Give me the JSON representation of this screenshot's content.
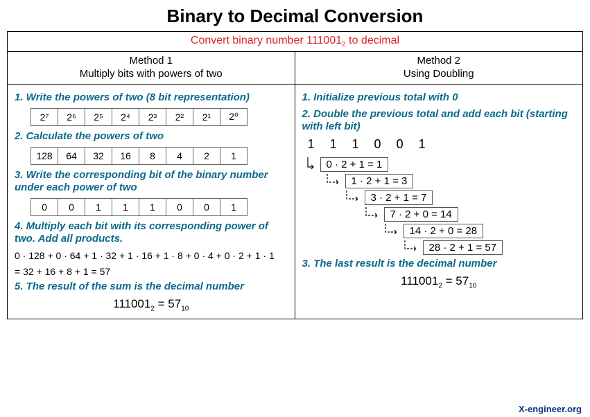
{
  "title": "Binary to Decimal Conversion",
  "prompt_prefix": "Convert binary number ",
  "prompt_bin": "111001",
  "prompt_suffix": " to decimal",
  "method1": {
    "name": "Method 1",
    "subtitle": "Multiply bits with powers of two",
    "step1": "1. Write the powers of two (8 bit representation)",
    "powers_labels": [
      "2⁷",
      "2⁶",
      "2⁵",
      "2⁴",
      "2³",
      "2²",
      "2¹",
      "2⁰"
    ],
    "step2": "2. Calculate the powers of two",
    "powers_values": [
      "128",
      "64",
      "32",
      "16",
      "8",
      "4",
      "2",
      "1"
    ],
    "step3": "3. Write the corresponding bit of the binary number under each power of two",
    "bits_row": [
      "0",
      "0",
      "1",
      "1",
      "1",
      "0",
      "0",
      "1"
    ],
    "step4": "4. Multiply each bit with its corresponding power of two. Add all products.",
    "calc_line1": "0 · 128 + 0 · 64 + 1 · 32 + 1 · 16 + 1 · 8 + 0 · 4 + 0 · 2 + 1 · 1",
    "calc_line2": "= 32 + 16 + 8 + 1 = 57",
    "step5": "5. The result of the sum is the decimal number",
    "result_bin": "111001",
    "result_dec": "57"
  },
  "method2": {
    "name": "Method 2",
    "subtitle": "Using Doubling",
    "step1": "1. Initialize previous total with 0",
    "step2": "2. Double the previous total and add each bit (starting with left bit)",
    "bits": [
      "1",
      "1",
      "1",
      "0",
      "0",
      "1"
    ],
    "doubling": [
      {
        "indent": 0,
        "expr": "0 · 2 + 1 = 1"
      },
      {
        "indent": 28,
        "expr": "1 · 2 + 1 = 3"
      },
      {
        "indent": 56,
        "expr": "3 · 2 + 1 = 7"
      },
      {
        "indent": 84,
        "expr": "7 · 2 + 0 = 14"
      },
      {
        "indent": 112,
        "expr": "14 · 2 + 0 = 28"
      },
      {
        "indent": 140,
        "expr": "28 · 2 + 1 = 57"
      }
    ],
    "step3": "3. The last result is the decimal number",
    "result_bin": "111001",
    "result_dec": "57"
  },
  "footer": "X-engineer.org"
}
